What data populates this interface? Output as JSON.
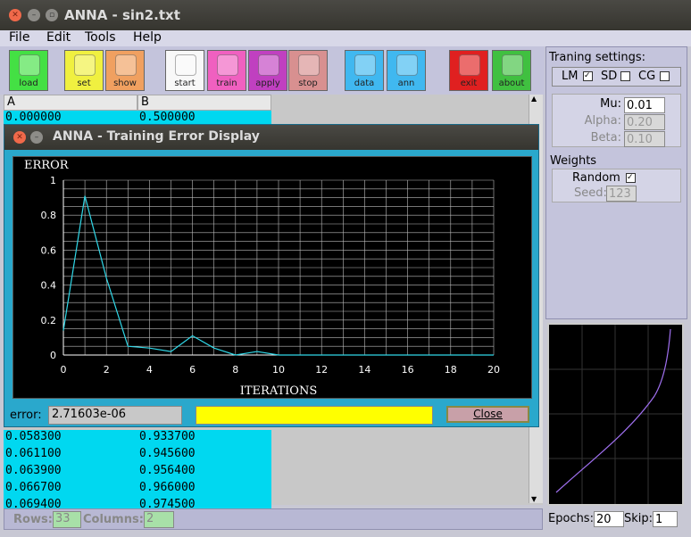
{
  "window": {
    "title": "ANNA - sin2.txt"
  },
  "menu": [
    "File",
    "Edit",
    "Tools",
    "Help"
  ],
  "toolbar": [
    {
      "label": "load",
      "icon": "load-icon",
      "bg": "#44e044"
    },
    {
      "label": "set",
      "icon": "sliders-icon",
      "bg": "#f0f040"
    },
    {
      "label": "show",
      "icon": "share-icon",
      "bg": "#f0a060"
    },
    {
      "label": "start",
      "icon": "check-icon",
      "bg": "#f8f8f8"
    },
    {
      "label": "train",
      "icon": "brain-icon",
      "bg": "#f060c0"
    },
    {
      "label": "apply",
      "icon": "wand-icon",
      "bg": "#c040c0"
    },
    {
      "label": "stop",
      "icon": "stop-icon",
      "bg": "#d89090"
    },
    {
      "label": "data",
      "icon": "floppy-icon",
      "bg": "#40b8f0"
    },
    {
      "label": "ann",
      "icon": "floppy-icon",
      "bg": "#40b8f0"
    },
    {
      "label": "exit",
      "icon": "x-icon",
      "bg": "#e02020"
    },
    {
      "label": "about",
      "icon": "info-icon",
      "bg": "#40c040"
    }
  ],
  "table": {
    "columns": [
      "A",
      "B"
    ],
    "top_rows": [
      [
        "0.000000",
        "0.500000"
      ]
    ],
    "bottom_rows": [
      [
        "0.058300",
        "0.933700"
      ],
      [
        "0.061100",
        "0.945600"
      ],
      [
        "0.063900",
        "0.956400"
      ],
      [
        "0.066700",
        "0.966000"
      ],
      [
        "0.069400",
        "0.974500"
      ]
    ]
  },
  "status": {
    "rows_label": "Rows:",
    "rows": "33",
    "cols_label": "Columns:",
    "cols": "2"
  },
  "settings": {
    "title": "Traning settings:",
    "lm": "LM",
    "sd": "SD",
    "cg": "CG",
    "mu_label": "Mu:",
    "mu": "0.01",
    "alpha_label": "Alpha:",
    "alpha": "0.20",
    "beta_label": "Beta:",
    "beta": "0.10",
    "weights_title": "Weights",
    "random_label": "Random",
    "seed_label": "Seed:",
    "seed": "123"
  },
  "bottom": {
    "epochs_label": "Epochs:",
    "epochs": "20",
    "skip_label": "Skip:",
    "skip": "1"
  },
  "dialog": {
    "title": "ANNA - Training Error Display",
    "error_label": "error:",
    "error_value": "2.71603e-06",
    "close_label": "Close",
    "progress": 1.0
  },
  "chart_data": {
    "type": "line",
    "title": "ERROR",
    "xlabel": "ITERATIONS",
    "ylabel": "",
    "xlim": [
      0,
      20
    ],
    "ylim": [
      0,
      1
    ],
    "xticks": [
      0,
      2,
      4,
      6,
      8,
      10,
      12,
      14,
      16,
      18,
      20
    ],
    "yticks": [
      0,
      0.2,
      0.4,
      0.6,
      0.8,
      1
    ],
    "grid": true,
    "series": [
      {
        "x": [
          0,
          1,
          2,
          3,
          4,
          5,
          6,
          7,
          8,
          9,
          10,
          11,
          12,
          13,
          14,
          15,
          16,
          17,
          18,
          19,
          20
        ],
        "y": [
          0.14,
          0.91,
          0.44,
          0.05,
          0.04,
          0.02,
          0.11,
          0.04,
          0.0,
          0.02,
          0.0,
          0.0,
          0.0,
          0.0,
          0.0,
          0.0,
          0.0,
          0.0,
          0.0,
          0.0,
          0.0
        ]
      }
    ],
    "color": "#30d8e8"
  }
}
